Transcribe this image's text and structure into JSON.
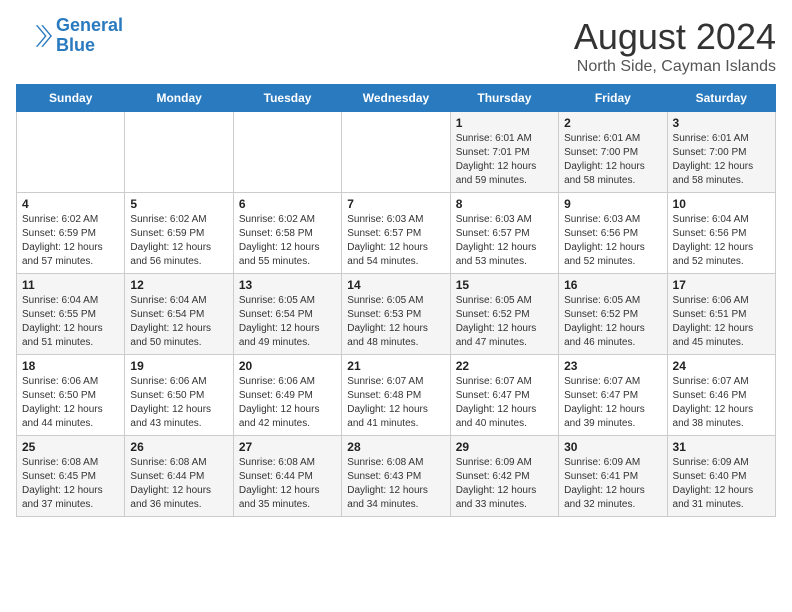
{
  "logo": {
    "line1": "General",
    "line2": "Blue"
  },
  "title": "August 2024",
  "subtitle": "North Side, Cayman Islands",
  "days_header": [
    "Sunday",
    "Monday",
    "Tuesday",
    "Wednesday",
    "Thursday",
    "Friday",
    "Saturday"
  ],
  "weeks": [
    [
      {
        "num": "",
        "info": ""
      },
      {
        "num": "",
        "info": ""
      },
      {
        "num": "",
        "info": ""
      },
      {
        "num": "",
        "info": ""
      },
      {
        "num": "1",
        "info": "Sunrise: 6:01 AM\nSunset: 7:01 PM\nDaylight: 12 hours\nand 59 minutes."
      },
      {
        "num": "2",
        "info": "Sunrise: 6:01 AM\nSunset: 7:00 PM\nDaylight: 12 hours\nand 58 minutes."
      },
      {
        "num": "3",
        "info": "Sunrise: 6:01 AM\nSunset: 7:00 PM\nDaylight: 12 hours\nand 58 minutes."
      }
    ],
    [
      {
        "num": "4",
        "info": "Sunrise: 6:02 AM\nSunset: 6:59 PM\nDaylight: 12 hours\nand 57 minutes."
      },
      {
        "num": "5",
        "info": "Sunrise: 6:02 AM\nSunset: 6:59 PM\nDaylight: 12 hours\nand 56 minutes."
      },
      {
        "num": "6",
        "info": "Sunrise: 6:02 AM\nSunset: 6:58 PM\nDaylight: 12 hours\nand 55 minutes."
      },
      {
        "num": "7",
        "info": "Sunrise: 6:03 AM\nSunset: 6:57 PM\nDaylight: 12 hours\nand 54 minutes."
      },
      {
        "num": "8",
        "info": "Sunrise: 6:03 AM\nSunset: 6:57 PM\nDaylight: 12 hours\nand 53 minutes."
      },
      {
        "num": "9",
        "info": "Sunrise: 6:03 AM\nSunset: 6:56 PM\nDaylight: 12 hours\nand 52 minutes."
      },
      {
        "num": "10",
        "info": "Sunrise: 6:04 AM\nSunset: 6:56 PM\nDaylight: 12 hours\nand 52 minutes."
      }
    ],
    [
      {
        "num": "11",
        "info": "Sunrise: 6:04 AM\nSunset: 6:55 PM\nDaylight: 12 hours\nand 51 minutes."
      },
      {
        "num": "12",
        "info": "Sunrise: 6:04 AM\nSunset: 6:54 PM\nDaylight: 12 hours\nand 50 minutes."
      },
      {
        "num": "13",
        "info": "Sunrise: 6:05 AM\nSunset: 6:54 PM\nDaylight: 12 hours\nand 49 minutes."
      },
      {
        "num": "14",
        "info": "Sunrise: 6:05 AM\nSunset: 6:53 PM\nDaylight: 12 hours\nand 48 minutes."
      },
      {
        "num": "15",
        "info": "Sunrise: 6:05 AM\nSunset: 6:52 PM\nDaylight: 12 hours\nand 47 minutes."
      },
      {
        "num": "16",
        "info": "Sunrise: 6:05 AM\nSunset: 6:52 PM\nDaylight: 12 hours\nand 46 minutes."
      },
      {
        "num": "17",
        "info": "Sunrise: 6:06 AM\nSunset: 6:51 PM\nDaylight: 12 hours\nand 45 minutes."
      }
    ],
    [
      {
        "num": "18",
        "info": "Sunrise: 6:06 AM\nSunset: 6:50 PM\nDaylight: 12 hours\nand 44 minutes."
      },
      {
        "num": "19",
        "info": "Sunrise: 6:06 AM\nSunset: 6:50 PM\nDaylight: 12 hours\nand 43 minutes."
      },
      {
        "num": "20",
        "info": "Sunrise: 6:06 AM\nSunset: 6:49 PM\nDaylight: 12 hours\nand 42 minutes."
      },
      {
        "num": "21",
        "info": "Sunrise: 6:07 AM\nSunset: 6:48 PM\nDaylight: 12 hours\nand 41 minutes."
      },
      {
        "num": "22",
        "info": "Sunrise: 6:07 AM\nSunset: 6:47 PM\nDaylight: 12 hours\nand 40 minutes."
      },
      {
        "num": "23",
        "info": "Sunrise: 6:07 AM\nSunset: 6:47 PM\nDaylight: 12 hours\nand 39 minutes."
      },
      {
        "num": "24",
        "info": "Sunrise: 6:07 AM\nSunset: 6:46 PM\nDaylight: 12 hours\nand 38 minutes."
      }
    ],
    [
      {
        "num": "25",
        "info": "Sunrise: 6:08 AM\nSunset: 6:45 PM\nDaylight: 12 hours\nand 37 minutes."
      },
      {
        "num": "26",
        "info": "Sunrise: 6:08 AM\nSunset: 6:44 PM\nDaylight: 12 hours\nand 36 minutes."
      },
      {
        "num": "27",
        "info": "Sunrise: 6:08 AM\nSunset: 6:44 PM\nDaylight: 12 hours\nand 35 minutes."
      },
      {
        "num": "28",
        "info": "Sunrise: 6:08 AM\nSunset: 6:43 PM\nDaylight: 12 hours\nand 34 minutes."
      },
      {
        "num": "29",
        "info": "Sunrise: 6:09 AM\nSunset: 6:42 PM\nDaylight: 12 hours\nand 33 minutes."
      },
      {
        "num": "30",
        "info": "Sunrise: 6:09 AM\nSunset: 6:41 PM\nDaylight: 12 hours\nand 32 minutes."
      },
      {
        "num": "31",
        "info": "Sunrise: 6:09 AM\nSunset: 6:40 PM\nDaylight: 12 hours\nand 31 minutes."
      }
    ]
  ]
}
